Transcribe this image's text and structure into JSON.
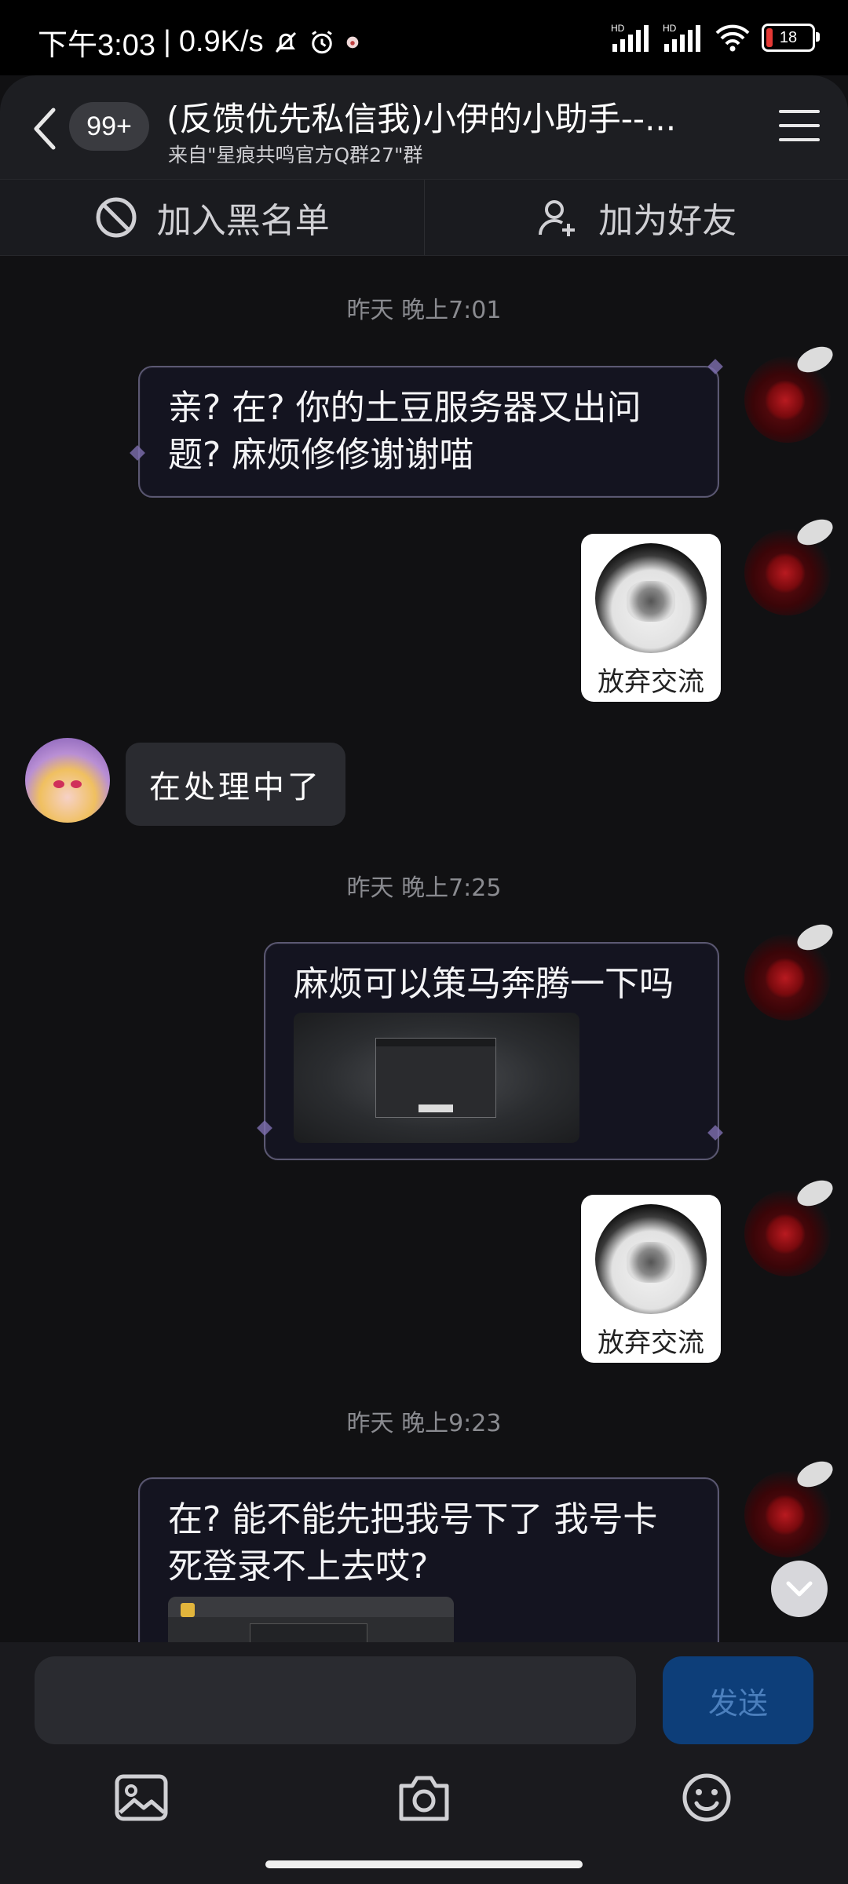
{
  "status_bar": {
    "time": "下午3:03",
    "separator": "|",
    "net_speed": "0.9K/s",
    "battery": "18",
    "hd1": "HD",
    "hd2": "HD"
  },
  "header": {
    "unread_badge": "99+",
    "title": "(反馈优先私信我)小伊的小助手--...",
    "subtitle": "来自\"星痕共鸣官方Q群27\"群"
  },
  "actions": {
    "blacklist": "加入黑名单",
    "add_friend": "加为好友"
  },
  "messages": {
    "t1": "昨天 晚上7:01",
    "m1": "亲? 在? 你的土豆服务器又出问题? 麻烦修修谢谢喵",
    "sticker_caption": "放弃交流",
    "reply": "在处理中了",
    "t2": "昨天 晚上7:25",
    "m2": "麻烦可以策马奔腾一下吗",
    "t3": "昨天 晚上9:23",
    "m3": "在? 能不能先把我号下了 我号卡死登录不上去哎?"
  },
  "composer": {
    "input_value": "",
    "send_label": "发送"
  },
  "colors": {
    "background": "#111113",
    "header_bg": "#1d1e22",
    "send_button_bg": "#0d3e79",
    "send_button_text": "#4b7fbd",
    "battery_low": "#e53935"
  }
}
